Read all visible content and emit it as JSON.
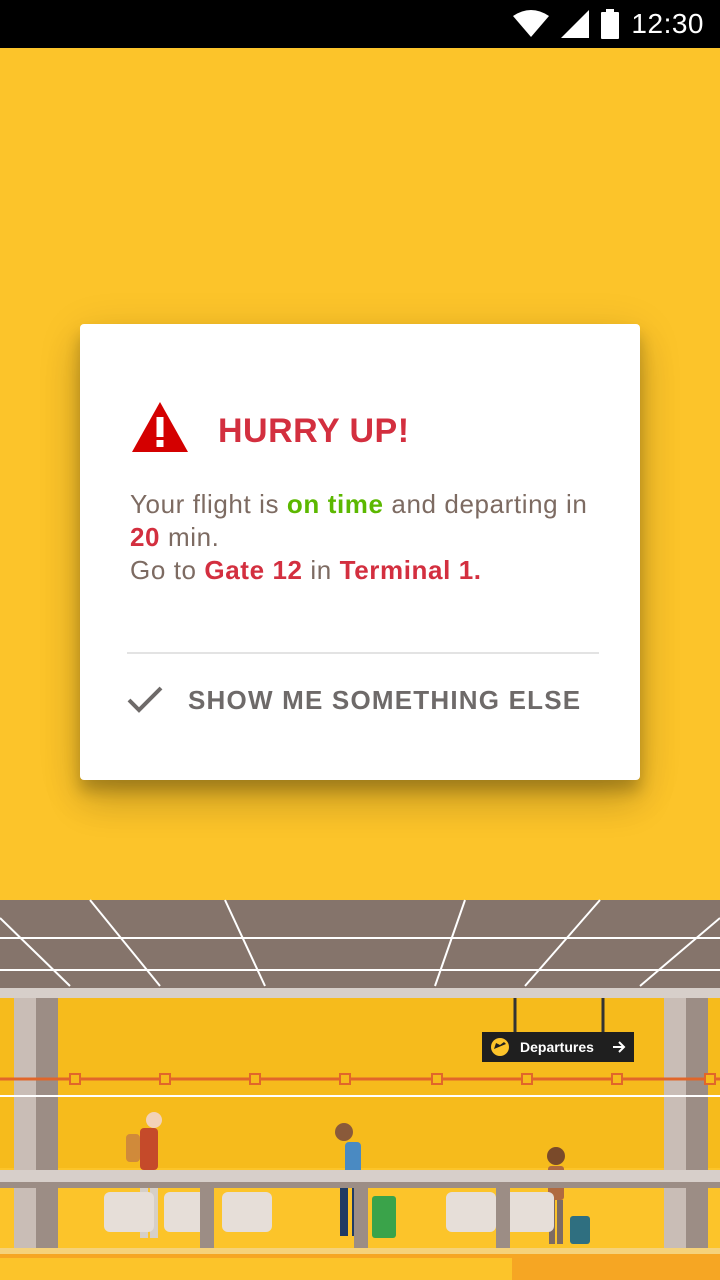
{
  "status_bar": {
    "time": "12:30",
    "icons": [
      "wifi-icon",
      "cell-signal-icon",
      "battery-icon"
    ]
  },
  "dialog": {
    "icon": "warning-triangle-icon",
    "title": "HURRY UP!",
    "body": {
      "line1_prefix": "Your flight is ",
      "status": "on time",
      "line1_suffix": " and departing in ",
      "minutes": "20",
      "minutes_suffix": " min.",
      "line2_prefix": "Go to ",
      "gate": "Gate 12",
      "line2_mid": " in ",
      "terminal": "Terminal 1."
    },
    "action": {
      "icon": "check-icon",
      "label": "SHOW ME SOMETHING ELSE"
    }
  },
  "illustration": {
    "sign_text": "Departures",
    "sign_icon": "plane-departure-icon",
    "sign_arrow": "arrow-right-icon"
  },
  "colors": {
    "background": "#fcc42a",
    "title_red": "#d32f3f",
    "on_time_green": "#5cb800",
    "body_text": "#7d6b62"
  }
}
